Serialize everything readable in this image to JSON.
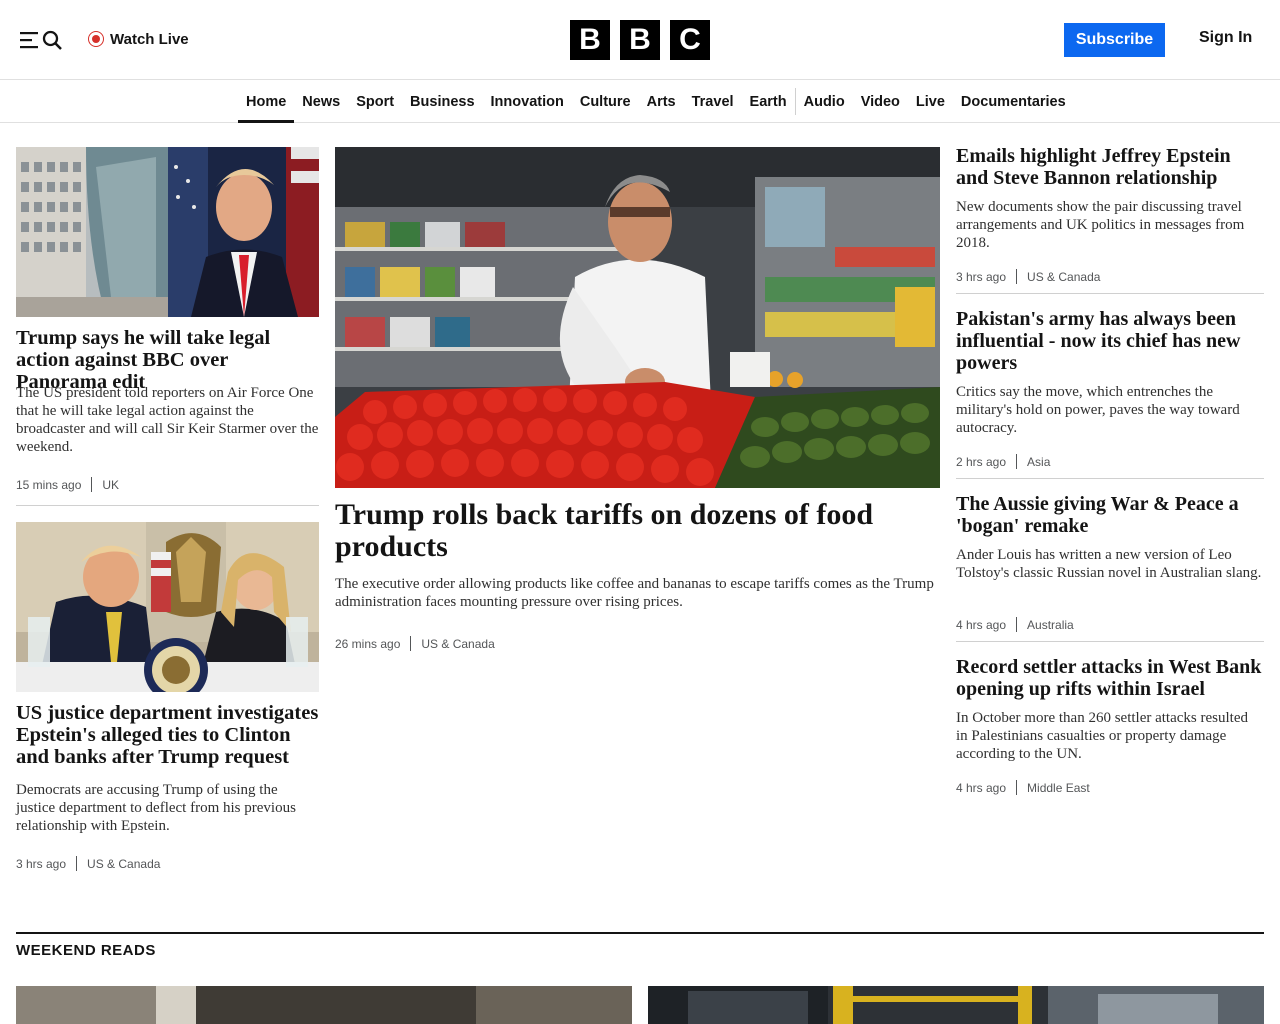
{
  "header": {
    "watch_live": "Watch Live",
    "logo_letters": [
      "B",
      "B",
      "C"
    ],
    "subscribe": "Subscribe",
    "sign_in": "Sign In"
  },
  "nav": {
    "items": [
      "Home",
      "News",
      "Sport",
      "Business",
      "Innovation",
      "Culture",
      "Arts",
      "Travel",
      "Earth",
      "Audio",
      "Video",
      "Live",
      "Documentaries"
    ],
    "active": "Home"
  },
  "left_col": [
    {
      "headline": "Trump says he will take legal action against BBC over Panorama edit",
      "summary": "The US president told reporters on Air Force One that he will take legal action against the broadcaster and will call Sir Keir Starmer over the weekend.",
      "time": "15 mins ago",
      "tag": "UK"
    },
    {
      "headline": "US justice department investigates Epstein's alleged ties to Clinton and banks after Trump request",
      "summary": "Democrats are accusing Trump of using the justice department to deflect from his previous relationship with Epstein.",
      "time": "3 hrs ago",
      "tag": "US & Canada"
    }
  ],
  "main_story": {
    "headline": "Trump rolls back tariffs on dozens of food products",
    "summary": "The executive order allowing products like coffee and bananas to escape tariffs comes as the Trump administration faces mounting pressure over rising prices.",
    "time": "26 mins ago",
    "tag": "US & Canada"
  },
  "right_col": [
    {
      "headline": "Emails highlight Jeffrey Epstein and Steve Bannon relationship",
      "summary": "New documents show the pair discussing travel arrangements and UK politics in messages from 2018.",
      "time": "3 hrs ago",
      "tag": "US & Canada"
    },
    {
      "headline": "Pakistan's army has always been influential - now its chief has new powers",
      "summary": "Critics say the move, which entrenches the military's hold on power, paves the way toward autocracy.",
      "time": "2 hrs ago",
      "tag": "Asia"
    },
    {
      "headline": "The Aussie giving War & Peace a 'bogan' remake",
      "summary": "Ander Louis has written a new version of Leo Tolstoy's classic Russian novel in Australian slang.",
      "time": "4 hrs ago",
      "tag": "Australia"
    },
    {
      "headline": "Record settler attacks in West Bank opening up rifts within Israel",
      "summary": "In October more than 260 settler attacks resulted in Palestinians casualties or property damage according to the UN.",
      "time": "4 hrs ago",
      "tag": "Middle East"
    }
  ],
  "section": {
    "title": "WEEKEND READS"
  },
  "colors": {
    "subscribe_bg": "#0c68f0",
    "live_red": "#d6302a",
    "text": "#141414"
  }
}
